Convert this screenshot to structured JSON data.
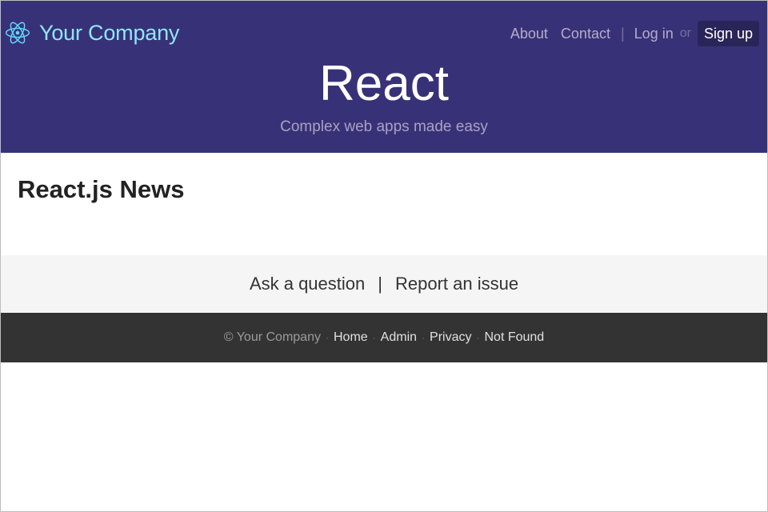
{
  "header": {
    "brand_name": "Your Company",
    "brand_icon": "react-logo-icon",
    "nav": {
      "about": "About",
      "contact": "Contact",
      "separator": "|",
      "login": "Log in",
      "or": "or",
      "signup": "Sign up"
    },
    "banner": {
      "title": "React",
      "description": "Complex web apps made easy"
    }
  },
  "main": {
    "heading": "React.js News"
  },
  "feedback": {
    "ask": "Ask a question",
    "separator": "|",
    "report": "Report an issue"
  },
  "footer": {
    "copyright": "© Your Company",
    "spacer": "·",
    "links": [
      "Home",
      "Admin",
      "Privacy",
      "Not Found"
    ]
  },
  "colors": {
    "header_bg": "#373277",
    "brand_text": "#92e5fc",
    "feedback_bg": "#f5f5f5",
    "footer_bg": "#333333"
  }
}
